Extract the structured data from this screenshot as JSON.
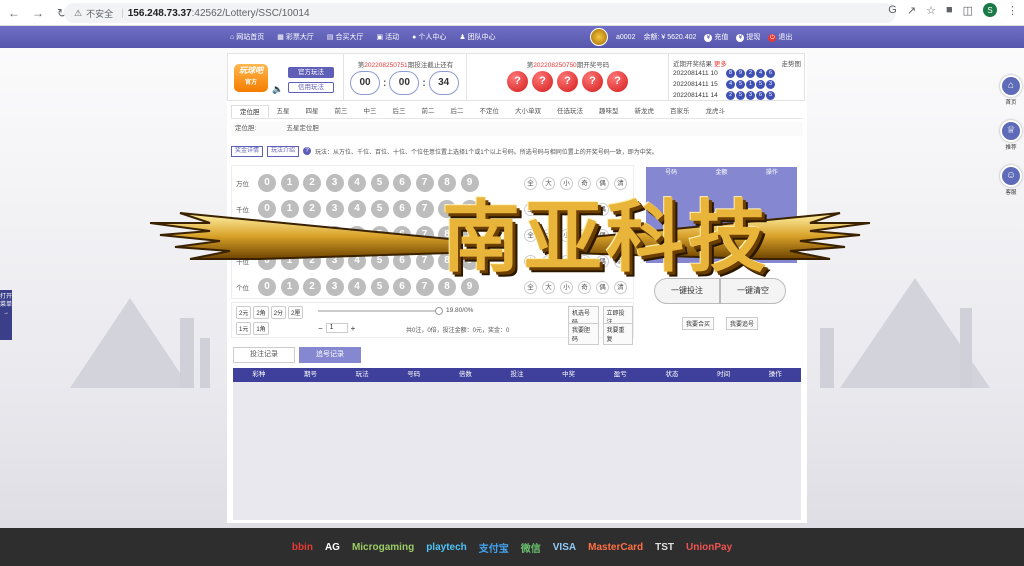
{
  "browser": {
    "insecure_label": "不安全",
    "host": "156.248.73.37",
    "path": ":42562/Lottery/SSC/10014",
    "profile_initial": "S"
  },
  "topnav": [
    "网站首页",
    "彩票大厅",
    "合买大厅",
    "活动",
    "个人中心",
    "团队中心"
  ],
  "user": {
    "name": "a0002",
    "balance_label": "余额:",
    "balance": "¥ 5620.402",
    "recharge": "充值",
    "withdraw": "提现",
    "logout": "退出"
  },
  "logo": {
    "name": "玩球吧",
    "sub": "官方"
  },
  "play_mode": {
    "official": "官方玩法",
    "credit": "信用玩法"
  },
  "countdown": {
    "prefix": "第",
    "issue": "202208250751",
    "suffix": "期投注截止还有",
    "hh": "00",
    "mm": "00",
    "ss": "34"
  },
  "draw": {
    "prefix": "第",
    "issue": "202208250750",
    "suffix": "期开奖号码",
    "balls": [
      "?",
      "?",
      "?",
      "?",
      "?"
    ]
  },
  "recent": {
    "title": "近期开奖结果",
    "more": "更多",
    "trend": "走势图",
    "rows": [
      {
        "issue": "2022081411 10",
        "nums": [
          "8",
          "9",
          "2",
          "4",
          "6"
        ]
      },
      {
        "issue": "2022081411 15",
        "nums": [
          "4",
          "5",
          "1",
          "5",
          "3"
        ]
      },
      {
        "issue": "2022081411 14",
        "nums": [
          "2",
          "5",
          "3",
          "6",
          "5"
        ]
      }
    ]
  },
  "tabs": [
    "定位胆",
    "五星",
    "四星",
    "前三",
    "中三",
    "后三",
    "前二",
    "后二",
    "不定位",
    "大小单双",
    "任选玩法",
    "趣味型",
    "新龙虎",
    "百家乐",
    "龙虎斗"
  ],
  "subtabs": [
    "定位胆:",
    "五星定位胆"
  ],
  "desc": {
    "btn1": "奖金详情",
    "btn2": "玩法介绍",
    "text": "玩法：从万位、千位、百位、十位、个位任意位置上选择1个或1个以上号码。所选号码与相同位置上的开奖号码一致，即为中奖。"
  },
  "positions": [
    "万位",
    "千位",
    "百位",
    "十位",
    "个位"
  ],
  "numbers": [
    "0",
    "1",
    "2",
    "3",
    "4",
    "5",
    "6",
    "7",
    "8",
    "9"
  ],
  "filters": [
    "全",
    "大",
    "小",
    "奇",
    "偶",
    "清"
  ],
  "units": [
    "2元",
    "2角",
    "2分",
    "2厘",
    "1元",
    "1角"
  ],
  "rebate": "19.80/0%",
  "multiplier": "1",
  "totals": "共0注，0倍，投注金额：0元，奖金：0",
  "side_btns": [
    "机选号码",
    "立即投注",
    "我要胆码",
    "我要重复"
  ],
  "cart_head": [
    "号码",
    "金额",
    "操作"
  ],
  "big_btns": [
    "一键投注",
    "一键清空"
  ],
  "small_btns": [
    "我要合买",
    "我要追号"
  ],
  "record_tabs": [
    "投注记录",
    "追号记录"
  ],
  "table_head": [
    "彩种",
    "期号",
    "玩法",
    "号码",
    "倍数",
    "投注",
    "中奖",
    "盈亏",
    "状态",
    "时间",
    "操作"
  ],
  "float_right": [
    "首页",
    "推荐",
    "客服"
  ],
  "float_left": "打开菜单",
  "watermark": "南亚科技",
  "payments": [
    "bbin",
    "AG",
    "Microgaming",
    "playtech",
    "支付宝",
    "微信",
    "VISA",
    "MasterCard",
    "TST",
    "UnionPay"
  ]
}
